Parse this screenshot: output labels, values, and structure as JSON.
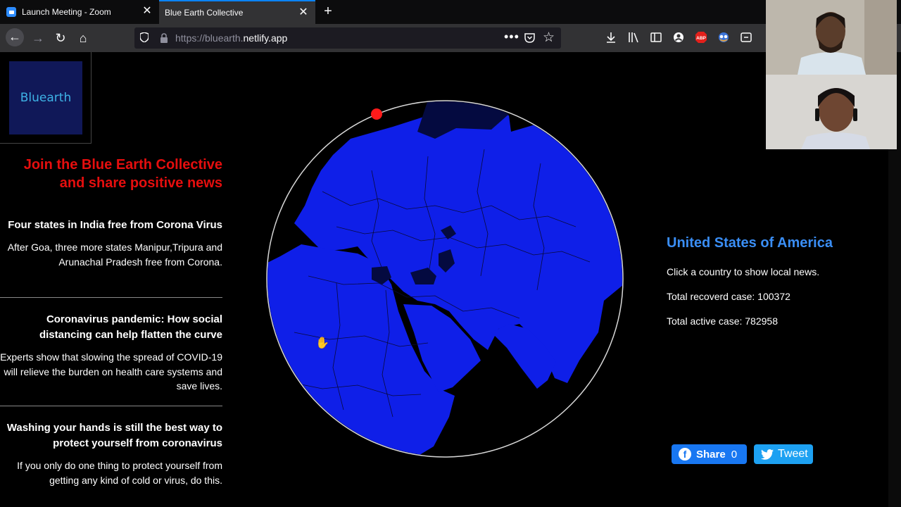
{
  "browser": {
    "tabs": [
      {
        "title": "Launch Meeting - Zoom"
      },
      {
        "title": "Blue Earth Collective"
      }
    ],
    "url_prefix": "https://bluearth.",
    "url_domain": "netlify.app"
  },
  "page": {
    "logo_text": "Bluearth",
    "headline": "Join the Blue Earth Collective and share positive news",
    "news": [
      {
        "title": "Four states in India free from Corona Virus",
        "body": "After Goa, three more states Manipur,Tripura and Arunachal Pradesh free from Corona."
      },
      {
        "title": "Coronavirus pandemic: How social distancing can help flatten the curve",
        "body": "Experts show that slowing the spread of COVID-19 will relieve the burden on health care systems and save lives."
      },
      {
        "title": "Washing your hands is still the best way to protect yourself from coronavirus",
        "body": "If you only do one thing to protect yourself from getting any kind of cold or virus, do this."
      }
    ],
    "info": {
      "country": "United States of America",
      "hint": "Click a country to show local news.",
      "recovered": "Total recoverd case: 100372",
      "active": "Total active case: 782958"
    },
    "share": {
      "label": "Share",
      "count": "0",
      "tweet_label": "Tweet"
    }
  },
  "colors": {
    "page_bg": "#000000",
    "headline": "#e50e0e",
    "country_title": "#3a8ef5",
    "globe_land": "#0f1fe8",
    "globe_dark": "#040a40",
    "logo_bg": "#101858",
    "logo_text": "#3eb3e6",
    "facebook": "#1877f2",
    "twitter": "#1da1f2"
  },
  "icons": [
    "zoom-icon",
    "close-icon",
    "plus-icon",
    "back-icon",
    "forward-icon",
    "reload-icon",
    "home-icon",
    "shield-icon",
    "lock-icon",
    "more-icon",
    "pocket-icon",
    "star-icon",
    "download-icon",
    "library-icon",
    "sidebar-icon",
    "account-icon",
    "adblock-icon",
    "extension-icon",
    "sync-icon",
    "hand-cursor-icon",
    "facebook-icon",
    "twitter-icon"
  ]
}
